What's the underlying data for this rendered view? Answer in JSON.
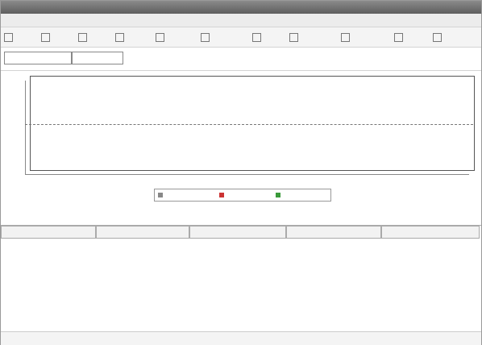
{
  "window": {
    "title": ""
  },
  "menu": [
    "",
    "",
    "",
    ""
  ],
  "toolbar": [
    "",
    "",
    "",
    "",
    "",
    "",
    "",
    "",
    "",
    "",
    ""
  ],
  "filter": {
    "category": "",
    "dates": ""
  },
  "chart_data": {
    "type": "line",
    "categories": [
      "",
      "",
      "",
      "",
      ""
    ],
    "ylabel": "",
    "legend": [
      "",
      "",
      ""
    ]
  },
  "nav": {
    "previous": "",
    "next": ""
  },
  "table": {
    "columns": [
      "",
      "",
      "",
      "",
      ""
    ],
    "rows": []
  },
  "status": {
    "text": ""
  }
}
